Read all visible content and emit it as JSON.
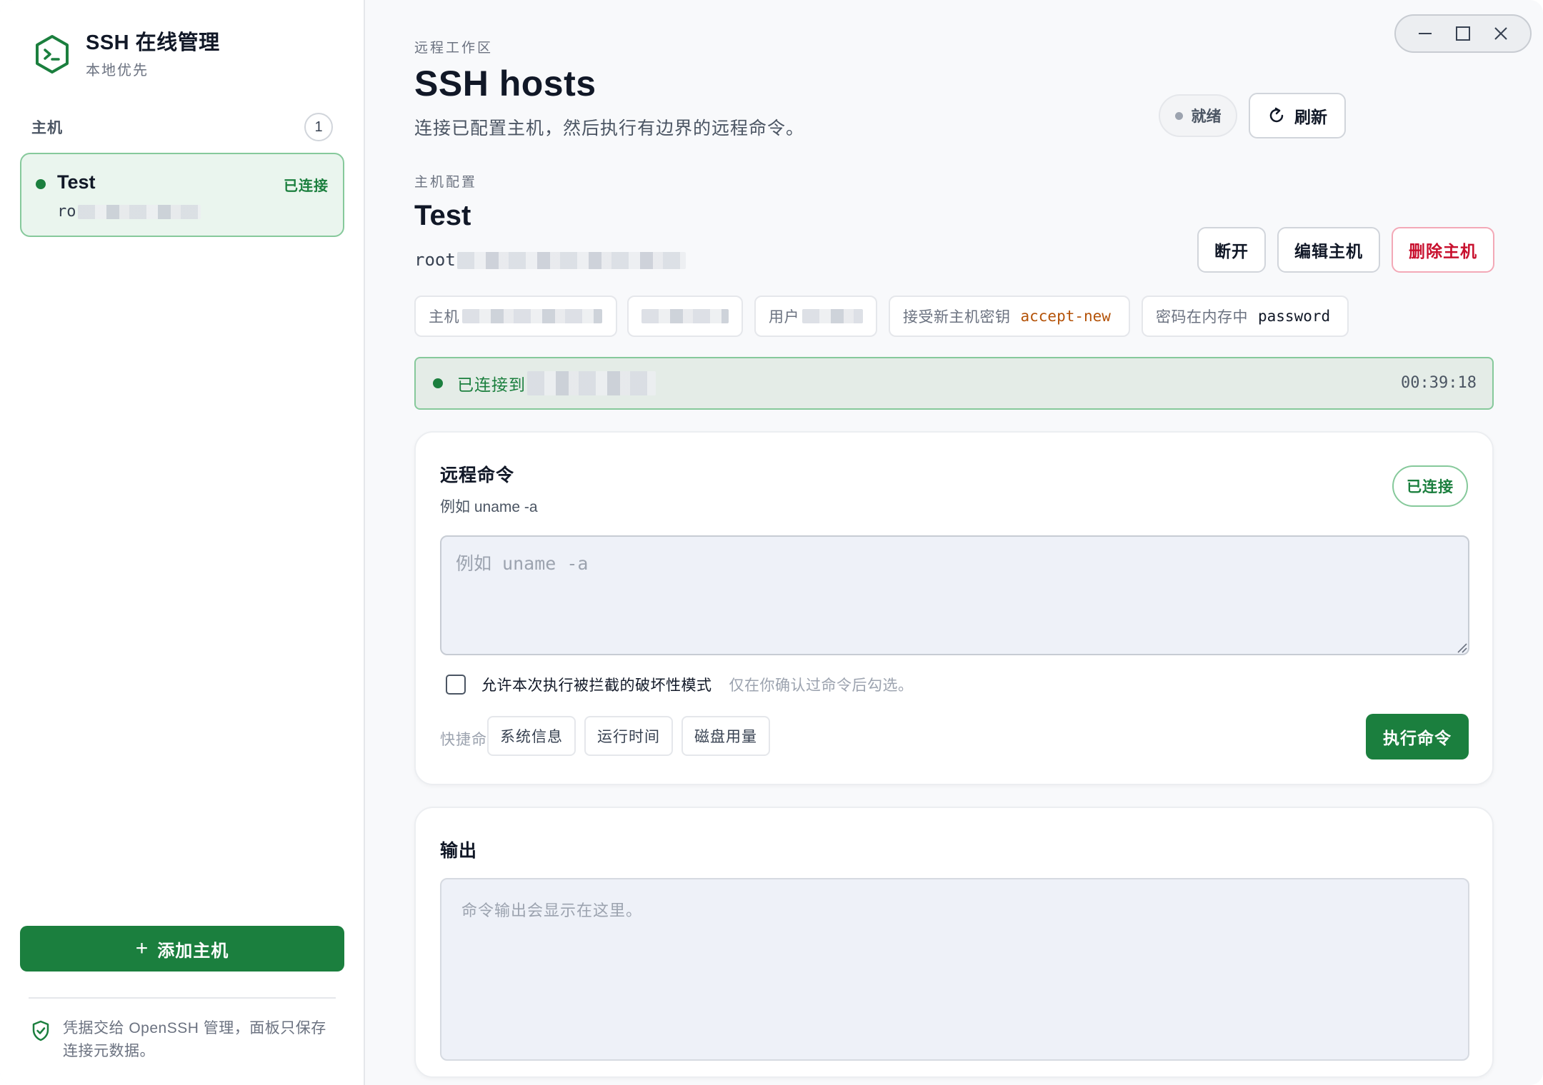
{
  "brand": {
    "title": "SSH 在线管理",
    "subtitle": "本地优先"
  },
  "sidebar": {
    "hosts_label": "主机",
    "hosts_count": "1",
    "hosts": [
      {
        "name": "Test",
        "state": "已连接",
        "address": "ro"
      }
    ],
    "add_host_label": "添加主机",
    "footer_text": "凭据交给 OpenSSH 管理，面板只保存连接元数据。"
  },
  "header": {
    "eyebrow": "远程工作区",
    "title": "SSH hosts",
    "subtitle": "连接已配置主机，然后执行有边界的远程命令。",
    "status": "就绪",
    "refresh_label": "刷新"
  },
  "host_config": {
    "eyebrow": "主机配置",
    "name": "Test",
    "address": "root",
    "actions": {
      "disconnect": "断开",
      "edit": "编辑主机",
      "delete": "删除主机"
    },
    "chips": {
      "host_label": "主机",
      "user_label": "用户",
      "hostkey_label": "接受新主机密钥",
      "hostkey_value": "accept-new",
      "password_label": "密码在内存中",
      "password_value": "password"
    },
    "connection": {
      "text": "已连接到",
      "elapsed": "00:39:18"
    }
  },
  "command_card": {
    "title": "远程命令",
    "hint": "例如 uname -a",
    "badge": "已连接",
    "placeholder": "例如 uname -a",
    "allow_destructive_label": "允许本次执行被拦截的破坏性模式",
    "allow_destructive_note": "仅在你确认过命令后勾选。",
    "quick_label": "快捷命令",
    "quick_commands": [
      "系统信息",
      "运行时间",
      "磁盘用量"
    ],
    "run_label": "执行命令"
  },
  "output_card": {
    "title": "输出",
    "placeholder": "命令输出会显示在这里。"
  },
  "colors": {
    "accent": "#1b7f3e",
    "accent_soft": "#eaf5ee",
    "danger": "#c8102e",
    "warn": "#b45309"
  }
}
